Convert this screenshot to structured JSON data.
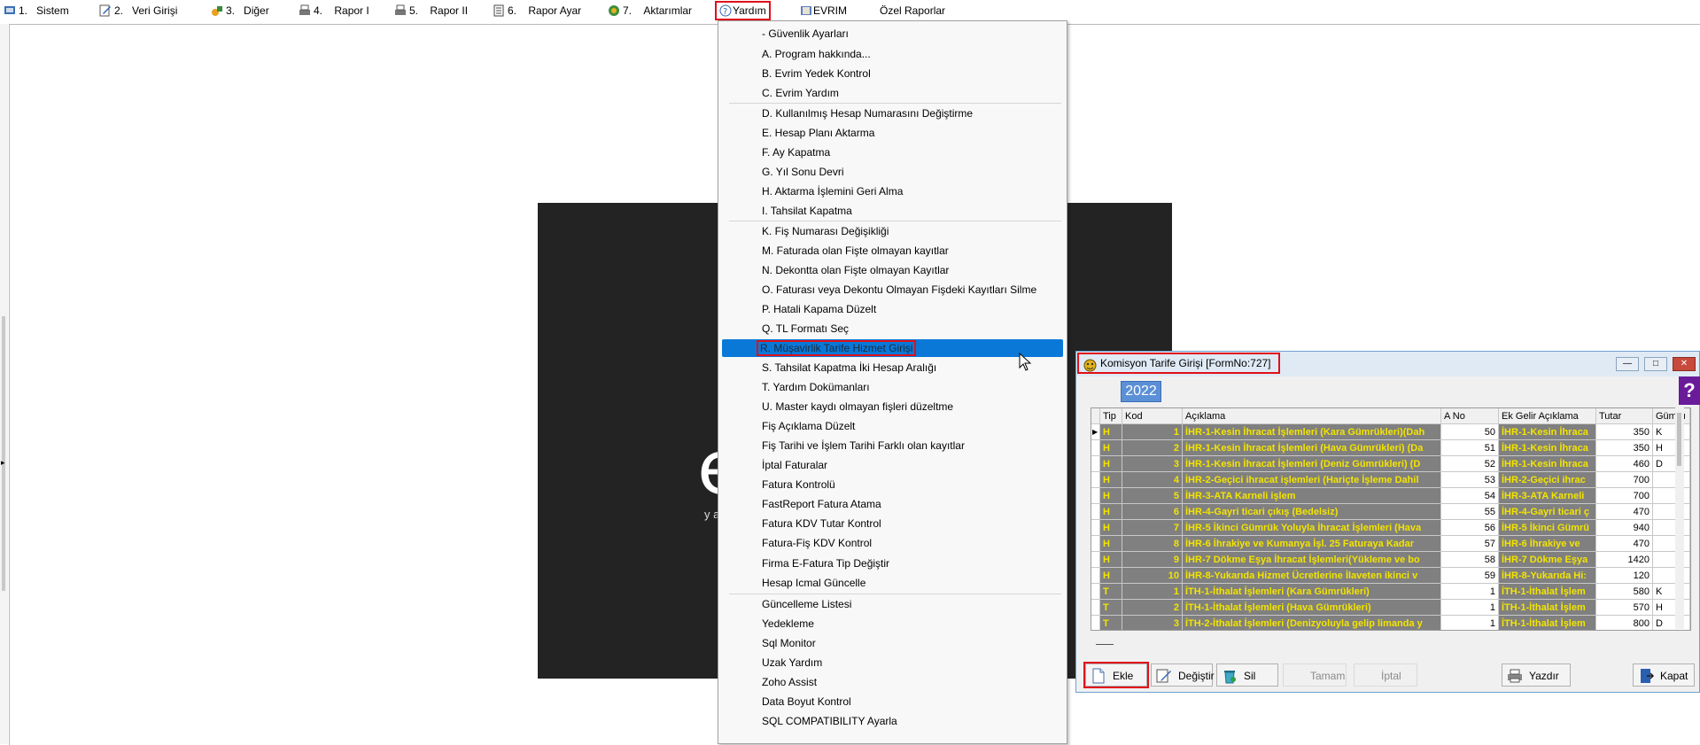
{
  "menubar": {
    "items": [
      {
        "label": "1.",
        "text": "Sistem"
      },
      {
        "label": "2.",
        "text": "Veri Girişi"
      },
      {
        "label": "3.",
        "text": "Diğer"
      },
      {
        "label": "4.",
        "text": "Rapor I"
      },
      {
        "label": "5.",
        "text": "Rapor II"
      },
      {
        "label": "6.",
        "text": "Rapor Ayar"
      },
      {
        "label": "7.",
        "text": "Aktarımlar"
      },
      {
        "label": "",
        "text": "Yardım"
      },
      {
        "label": "",
        "text": "EVRIM"
      },
      {
        "label": "",
        "text": "Özel Raporlar"
      }
    ]
  },
  "dropdown": {
    "items": [
      "- Güvenlik Ayarları",
      "A.   Program hakkında...",
      "B.   Evrim Yedek Kontrol",
      "C.   Evrim Yardım",
      "D.   Kullanılmış Hesap Numarasını Değiştirme",
      "E.   Hesap Planı Aktarma",
      "F.   Ay Kapatma",
      "G.   Yıl Sonu Devri",
      "H.   Aktarma İşlemini Geri Alma",
      "I.   Tahsilat Kapatma",
      "K.  Fiş Numarası Değişikliği",
      "M. Faturada olan Fişte olmayan kayıtlar",
      "N.  Dekontta olan Fişte olmayan Kayıtlar",
      "O. Faturası veya Dekontu Olmayan Fişdeki Kayıtları Silme",
      "P. Hatali Kapama Düzelt",
      "Q. TL Formatı Seç",
      "R. Müşavirlik Tarife Hizmet Girişi",
      "S.   Tahsilat Kapatma İki Hesap Aralığı",
      "T. Yardım Dokümanları",
      "U. Master kaydı olmayan fişleri düzeltme",
      "Fiş Açıklama Düzelt",
      "Fiş Tarihi ve İşlem Tarihi Farklı olan kayıtlar",
      "İptal Faturalar",
      "Fatura Kontrolü",
      "FastReport Fatura Atama",
      "Fatura KDV Tutar Kontrol",
      "Fatura-Fiş KDV Kontrol",
      "Firma E-Fatura Tip Değiştir",
      "Hesap Icmal Güncelle",
      "Güncelleme Listesi",
      "Yedekleme",
      "Sql Monitor",
      "Uzak Yardım",
      "Zoho Assist",
      "Data Boyut Kontrol",
      "SQL COMPATIBILITY Ayarla"
    ],
    "selected_index": 16
  },
  "splash": {
    "big_text": "e",
    "small_text": "y a"
  },
  "window": {
    "title": "Komisyon Tarife Girişi [FormNo:727]",
    "year": "2022",
    "help": "?",
    "min": "—",
    "max": "□",
    "close": "✕",
    "columns": [
      "Tip",
      "Kod",
      "Açıklama",
      "A No",
      "Ek Gelir Açıklama",
      "Tutar",
      "Gümrü"
    ],
    "rows": [
      {
        "tip": "H",
        "kod": "1",
        "aciklama": "İHR-1-Kesin İhracat İşlemleri (Kara Gümrükleri)(Dah",
        "ano": "50",
        "ek": "İHR-1-Kesin İhraca",
        "tutar": "350",
        "gum": "K"
      },
      {
        "tip": "H",
        "kod": "2",
        "aciklama": "İHR-1-Kesin İhracat İşlemleri (Hava Gümrükleri) (Da",
        "ano": "51",
        "ek": "İHR-1-Kesin İhraca",
        "tutar": "350",
        "gum": "H"
      },
      {
        "tip": "H",
        "kod": "3",
        "aciklama": "İHR-1-Kesin İhracat İşlemleri (Deniz Gümrükleri) (D",
        "ano": "52",
        "ek": "İHR-1-Kesin İhraca",
        "tutar": "460",
        "gum": "D"
      },
      {
        "tip": "H",
        "kod": "4",
        "aciklama": "İHR-2-Geçici ihracat işlemleri (Hariçte İşleme Dahil",
        "ano": "53",
        "ek": "İHR-2-Geçici ihrac",
        "tutar": "700",
        "gum": ""
      },
      {
        "tip": "H",
        "kod": "5",
        "aciklama": "İHR-3-ATA Karneli işlem",
        "ano": "54",
        "ek": "İHR-3-ATA Karneli",
        "tutar": "700",
        "gum": ""
      },
      {
        "tip": "H",
        "kod": "6",
        "aciklama": "İHR-4-Gayri ticari çıkış (Bedelsiz)",
        "ano": "55",
        "ek": "İHR-4-Gayri ticari ç",
        "tutar": "470",
        "gum": ""
      },
      {
        "tip": "H",
        "kod": "7",
        "aciklama": "İHR-5 İkinci Gümrük Yoluyla İhracat İşlemleri (Hava",
        "ano": "56",
        "ek": "İHR-5 İkinci Gümrü",
        "tutar": "940",
        "gum": ""
      },
      {
        "tip": "H",
        "kod": "8",
        "aciklama": "İHR-6 İhrakiye ve Kumanya İşl. 25 Faturaya Kadar",
        "ano": "57",
        "ek": "İHR-6 İhrakiye ve",
        "tutar": "470",
        "gum": ""
      },
      {
        "tip": "H",
        "kod": "9",
        "aciklama": "İHR-7 Dökme Eşya İhracat İşlemleri(Yükleme ve bo",
        "ano": "58",
        "ek": "İHR-7 Dökme Eşya",
        "tutar": "1420",
        "gum": ""
      },
      {
        "tip": "H",
        "kod": "10",
        "aciklama": "İHR-8-Yukarıda Hizmet Ücretlerine İlaveten ikinci v",
        "ano": "59",
        "ek": "İHR-8-Yukarıda Hi:",
        "tutar": "120",
        "gum": ""
      },
      {
        "tip": "T",
        "kod": "1",
        "aciklama": "İTH-1-İthalat İşlemleri  (Kara Gümrükleri)",
        "ano": "1",
        "ek": "İTH-1-İthalat İşlem",
        "tutar": "580",
        "gum": "K"
      },
      {
        "tip": "T",
        "kod": "2",
        "aciklama": "İTH-1-İthalat İşlemleri  (Hava Gümrükleri)",
        "ano": "1",
        "ek": "İTH-1-İthalat İşlem",
        "tutar": "570",
        "gum": "H"
      },
      {
        "tip": "T",
        "kod": "3",
        "aciklama": "İTH-2-İthalat İşlemleri (Denizyoluyla gelip limanda y",
        "ano": "1",
        "ek": "İTH-1-İthalat İşlem",
        "tutar": "800",
        "gum": "D"
      }
    ],
    "buttons": {
      "ekle": "Ekle",
      "degistir": "Değiştir",
      "sil": "Sil",
      "tamam": "Tamam",
      "iptal": "İptal",
      "yazdir": "Yazdır",
      "kapat": "Kapat"
    }
  },
  "colors": {
    "menu_highlight": "#0a78d7",
    "annotation_red": "#e0101a",
    "grid_cell_grey": "#808080",
    "grid_text_yellow": "#f3e400"
  }
}
